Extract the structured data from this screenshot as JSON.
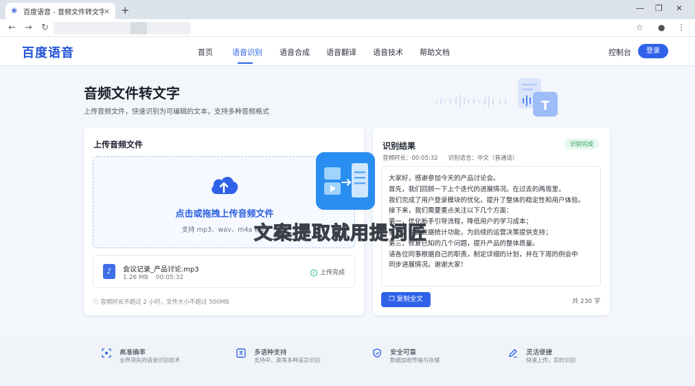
{
  "browser": {
    "tab_title": "百度语音 - 音频文件转文字",
    "tab_close": "×",
    "new_tab": "+"
  },
  "header": {
    "logo": "百度语音",
    "nav": [
      "首页",
      "语音识别",
      "语音合成",
      "语音翻译",
      "语音技术",
      "帮助文档"
    ],
    "active_nav": "语音识别",
    "console": "控制台",
    "login": "登录"
  },
  "hero": {
    "title": "音频文件转文字",
    "subtitle": "上传音频文件，快速识别为可编辑的文本，支持多种音频格式"
  },
  "upload": {
    "title": "上传音频文件",
    "drop_title": "点击或拖拽上传音频文件",
    "drop_hint": "支持 mp3、wav、m4a 格式",
    "file": {
      "name": "会议记录_产品讨论.mp3",
      "size": "1.26 MB",
      "duration": "00:05:32",
      "status": "上传完成"
    },
    "limit_note": "音频时长不超过 2 小时，文件大小不超过 500MB"
  },
  "result": {
    "title": "识别结果",
    "badge": "识别完成",
    "duration_label": "音频时长：00:05:32",
    "language_label": "识别语言：中文（普通话）",
    "lines": [
      "大家好，感谢参加今天的产品讨论会。",
      "首先，我们回顾一下上个迭代的进展情况。在过去的两周里，",
      "我们完成了用户登录模块的优化，提升了整体的稳定性和用户体验。",
      "接下来，我们需要重点关注以下几个方面：",
      "第一，优化新手引导流程，降低用户的学习成本；",
      "第二，完善数据统计功能，为后续的运营决策提供支持；",
      "第三，修复已知的几个问题，提升产品的整体质量。",
      "请各位同事根据自己的职责，制定详细的计划，并在下周的例会中",
      "同步进展情况。谢谢大家！"
    ],
    "copy_button": "复制全文",
    "char_count": "共 230 字"
  },
  "watermark": "文案提取就用提词匠",
  "features": [
    {
      "icon": "scan-icon",
      "title": "高准确率",
      "desc": "业界领先的语音识别技术"
    },
    {
      "icon": "translate-icon",
      "title": "多语种支持",
      "desc": "支持中、英等多种语言识别"
    },
    {
      "icon": "shield-icon",
      "title": "安全可靠",
      "desc": "数据加密传输与存储"
    },
    {
      "icon": "pen-icon",
      "title": "灵活便捷",
      "desc": "快速上传，实时识别"
    }
  ],
  "colors": {
    "accent": "#2f62e8",
    "success": "#2aa466",
    "background": "#f3f6fb"
  }
}
